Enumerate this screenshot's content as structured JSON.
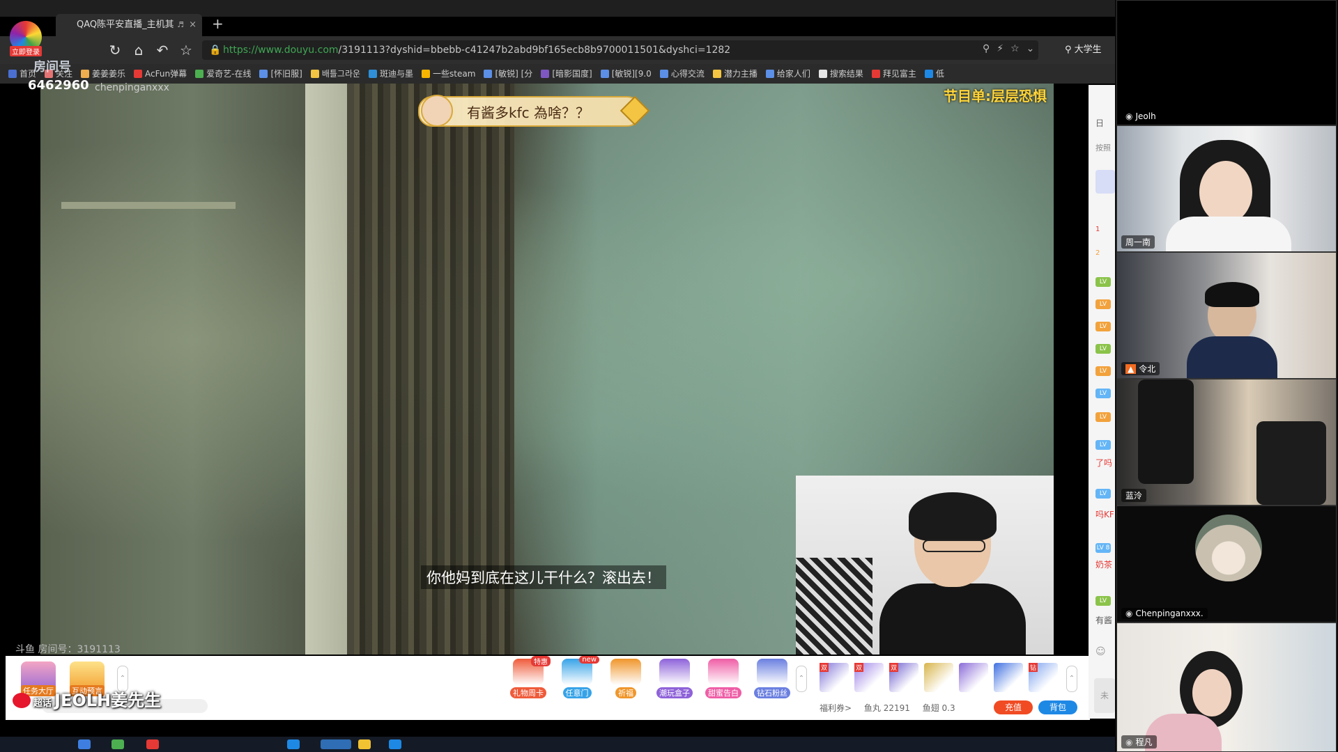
{
  "browser": {
    "tab_title": "QAQ陈平安直播_主机其他",
    "new_tab": "+",
    "tab_close": "×",
    "url_domain": "https://www.douyu.com",
    "url_path": "/3191113?dyshid=bbebb-c41247b2abd9bf165ecb8b9700011501&dyshci=1282",
    "search_text": "大学生",
    "bookmarks": [
      "首页",
      "关注",
      "姜姜姜乐",
      "AcFun弹幕",
      "爱奇艺-在线",
      "[怀旧服]",
      "배틀그라운",
      "斑迪与墨",
      "一些steam",
      "[敏锐] [分",
      "[暗影国度]",
      "[敏锐][9.0",
      "心得交流",
      "潜力主播",
      "给家人们",
      "搜索结果",
      "拜见富主",
      "低"
    ]
  },
  "stream": {
    "login_badge": "立即登录",
    "room_label": "房间号",
    "viewer_count": "6462960",
    "host_name": "chenpinganxxx",
    "program_label": "节目单:层层恐惧",
    "danmu_text": "有酱多kfc 為啥？？",
    "subtitle": "你他妈到底在这儿干什么？滚出去！",
    "room_number": "斗鱼 房间号：3191113"
  },
  "giftbar": {
    "left_items": [
      "任务大厅",
      "互动预言"
    ],
    "weibo_prefix": "超话",
    "weibo_name": "JEOLH姜先生",
    "gifts": [
      {
        "label": "礼物周卡",
        "tag": "特惠",
        "color": "#ef5b3a"
      },
      {
        "label": "任意门",
        "tag": "new",
        "color": "#36a3e8"
      },
      {
        "label": "祈福",
        "tag": "",
        "color": "#f0962b"
      },
      {
        "label": "潮玩盒子",
        "tag": "",
        "color": "#8e62d9"
      },
      {
        "label": "甜蜜告白",
        "tag": "",
        "color": "#ef5da6"
      },
      {
        "label": "钻石粉丝",
        "tag": "",
        "color": "#6a7fe0"
      }
    ],
    "pack_badge": "双",
    "pack_badge_alt": "钻",
    "wallet": {
      "welfare": "福利券>",
      "fishball": "鱼丸 22191",
      "fishfin": "鱼翅 0.3"
    },
    "recharge": "充值",
    "bag": "背包"
  },
  "chatstrip": {
    "tab_char": "日",
    "sort_char": "按照",
    "rank1": "1",
    "rank2": "2",
    "lv": "LV",
    "lv_alt": "LV 8",
    "frags": [
      "了吗",
      "吗KF",
      "奶茶",
      "有酱"
    ],
    "shop_char": "未"
  },
  "discord": {
    "tiles": [
      {
        "name": "Jeolh"
      },
      {
        "name": "周一南"
      },
      {
        "name": "令北"
      },
      {
        "name": "蓝泠"
      },
      {
        "name": "Chenpinganxxx."
      },
      {
        "name": "程凡"
      }
    ]
  }
}
